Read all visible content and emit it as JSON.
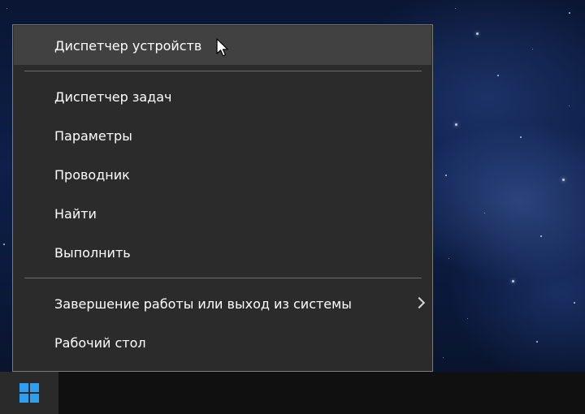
{
  "context_menu": {
    "items": [
      {
        "label": "Диспетчер устройств",
        "hovered": true
      },
      {
        "label": "Диспетчер задач"
      },
      {
        "label": "Параметры"
      },
      {
        "label": "Проводник"
      },
      {
        "label": "Найти"
      },
      {
        "label": "Выполнить"
      },
      {
        "label": "Завершение работы или выход из системы",
        "has_submenu": true
      },
      {
        "label": "Рабочий стол"
      }
    ]
  },
  "taskbar": {
    "start_icon": "windows-logo-icon",
    "accent_color": "#2fa0ef"
  },
  "colors": {
    "menu_background": "#2b2b2b",
    "menu_hover": "#414141",
    "menu_text": "#ffffff",
    "taskbar": "#101010"
  }
}
